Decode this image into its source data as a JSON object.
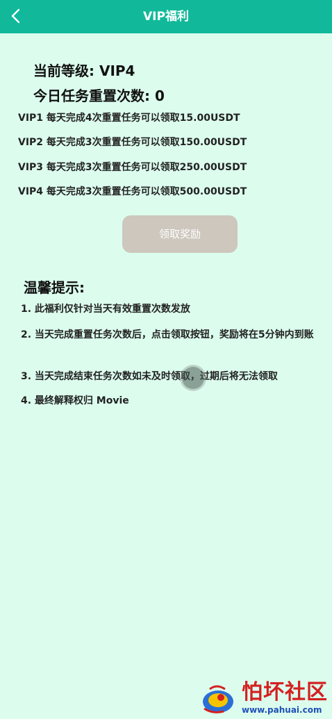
{
  "header": {
    "title": "VIP福利",
    "back_icon": "chevron-left-icon"
  },
  "status": {
    "current_level": "当前等级: VIP4",
    "reset_count": "今日任务重置次数: 0"
  },
  "rules": [
    "VIP1 每天完成4次重置任务可以领取15.00USDT",
    "VIP2 每天完成3次重置任务可以领取150.00USDT",
    "VIP3 每天完成3次重置任务可以领取250.00USDT",
    "VIP4 每天完成3次重置任务可以领取500.00USDT"
  ],
  "claim_button": {
    "label": "领取奖励",
    "state": "disabled"
  },
  "tips": {
    "title": "温馨提示:",
    "items": [
      "1. 此福利仅针对当天有效重置次数发放",
      "2. 当天完成重置任务次数后，点击领取按钮，奖励将在5分钟内到账",
      "3. 当天完成结束任务次数如未及时领取，过期后将无法领取",
      "4. 最终解释权归 Movie"
    ]
  },
  "watermark": {
    "name": "怕坏社区",
    "url": "www.pahuai.com"
  },
  "colors": {
    "header": "#11b99a",
    "background": "#dcfdee",
    "button_disabled": "#cdc7bd",
    "watermark_red": "#d42020",
    "watermark_blue": "#1f4fb8"
  }
}
